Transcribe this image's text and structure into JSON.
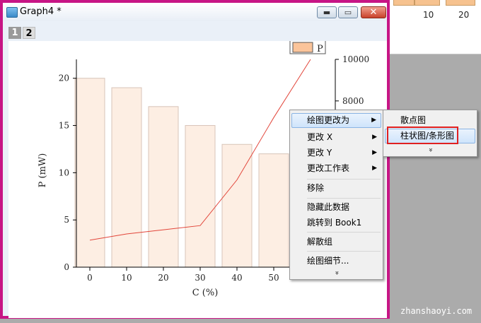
{
  "window": {
    "title": "Graph4 *",
    "buttons": {
      "minimize": "▬",
      "maximize": "▭",
      "close": "✕"
    },
    "layers": [
      "1",
      "2"
    ]
  },
  "worksheet": {
    "ticks": [
      "10",
      "20"
    ]
  },
  "colors": {
    "bar_fill": "#fdeee3",
    "bar_edge": "#d8c4b8",
    "line": "#e2453a",
    "legend_fill": "#fbc49a",
    "window_border": "#c71585"
  },
  "chart_data": {
    "type": "bar",
    "categories": [
      "0",
      "10",
      "20",
      "30",
      "40",
      "50"
    ],
    "values": [
      20,
      19,
      17,
      15,
      13,
      12
    ],
    "xlabel": "C (%)",
    "ylabel": "P (mW)",
    "ylim": [
      0,
      22
    ],
    "yticks": [
      "0",
      "5",
      "10",
      "15",
      "20"
    ],
    "legend": {
      "entries": [
        "P"
      ],
      "placement": "top-right"
    },
    "right_axis": {
      "ticks": [
        "10000",
        "8000"
      ],
      "ylim": [
        0,
        10000
      ]
    },
    "line_series": {
      "x": [
        0,
        10,
        20,
        30,
        40,
        50,
        60
      ],
      "values": [
        1300,
        1600,
        1800,
        2000,
        4200,
        7200,
        10000
      ]
    }
  },
  "context_menu": {
    "items": [
      {
        "label": "绘图更改为",
        "submenu": true
      },
      {
        "label": "更改 X",
        "submenu": true
      },
      {
        "label": "更改 Y",
        "submenu": true
      },
      {
        "label": "更改工作表",
        "submenu": true
      },
      {
        "label": "移除",
        "submenu": false
      },
      {
        "label": "隐藏此数据",
        "submenu": false
      },
      {
        "label": "跳转到 Book1",
        "submenu": false
      },
      {
        "label": "解散组",
        "submenu": false
      },
      {
        "label": "绘图细节...",
        "submenu": false
      }
    ],
    "more": "»"
  },
  "submenu": {
    "items": [
      {
        "label": "散点图"
      },
      {
        "label": "柱状图/条形图"
      }
    ],
    "more": "»"
  },
  "watermark": "zhanshaoyi.com"
}
